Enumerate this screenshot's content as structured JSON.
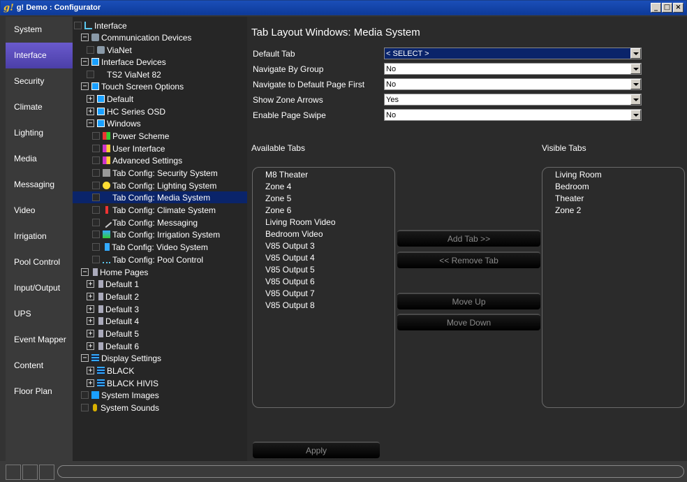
{
  "window": {
    "logo": "g!",
    "title": "g! Demo : Configurator"
  },
  "nav": [
    "System",
    "Interface",
    "Security",
    "Climate",
    "Lighting",
    "Media",
    "Messaging",
    "Video",
    "Irrigation",
    "Pool Control",
    "Input/Output",
    "UPS",
    "Event Mapper",
    "Content",
    "Floor Plan"
  ],
  "tree": [
    {
      "label": "Interface"
    },
    {
      "label": "Communication Devices"
    },
    {
      "label": "ViaNet"
    },
    {
      "label": "Interface Devices"
    },
    {
      "label": "TS2 ViaNet 82"
    },
    {
      "label": "Touch Screen Options"
    },
    {
      "label": "Default"
    },
    {
      "label": "HC Series OSD"
    },
    {
      "label": "Windows"
    },
    {
      "label": "Power Scheme"
    },
    {
      "label": "User Interface"
    },
    {
      "label": "Advanced Settings"
    },
    {
      "label": "Tab Config: Security System"
    },
    {
      "label": "Tab Config: Lighting System"
    },
    {
      "label": "Tab Config: Media System"
    },
    {
      "label": "Tab Config: Climate System"
    },
    {
      "label": "Tab Config: Messaging"
    },
    {
      "label": "Tab Config: Irrigation System"
    },
    {
      "label": "Tab Config: Video System"
    },
    {
      "label": "Tab Config: Pool Control"
    },
    {
      "label": "Home Pages"
    },
    {
      "label": "Default 1"
    },
    {
      "label": "Default 2"
    },
    {
      "label": "Default 3"
    },
    {
      "label": "Default 4"
    },
    {
      "label": "Default 5"
    },
    {
      "label": "Default 6"
    },
    {
      "label": "Display Settings"
    },
    {
      "label": "BLACK"
    },
    {
      "label": "BLACK HIVIS"
    },
    {
      "label": "System Images"
    },
    {
      "label": "System Sounds"
    }
  ],
  "main": {
    "title": "Tab Layout Windows: Media System",
    "fields": [
      {
        "label": "Default Tab",
        "value": "< SELECT >"
      },
      {
        "label": "Navigate By Group",
        "value": "No"
      },
      {
        "label": "Navigate to Default Page First",
        "value": "No"
      },
      {
        "label": "Show Zone Arrows",
        "value": "Yes"
      },
      {
        "label": "Enable Page Swipe",
        "value": "No"
      }
    ],
    "available_label": "Available Tabs",
    "visible_label": "Visible Tabs",
    "available": [
      "M8 Theater",
      "Zone 4",
      "Zone 5",
      "Zone 6",
      "Living Room Video",
      "Bedroom Video",
      "V85 Output 3",
      "V85 Output 4",
      "V85 Output 5",
      "V85 Output 6",
      "V85 Output 7",
      "V85 Output 8"
    ],
    "visible": [
      "Living Room",
      "Bedroom",
      "Theater",
      "Zone 2"
    ],
    "buttons": {
      "add": "Add Tab >>",
      "remove": "<< Remove Tab",
      "up": "Move Up",
      "down": "Move Down",
      "apply": "Apply"
    }
  }
}
